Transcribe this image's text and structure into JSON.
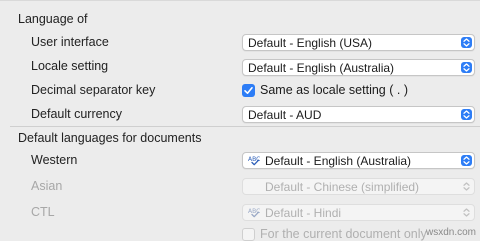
{
  "language_of": {
    "title": "Language of",
    "rows": [
      {
        "label": "User interface",
        "value": "Default - English (USA)"
      },
      {
        "label": "Locale setting",
        "value": "Default - English (Australia)"
      },
      {
        "label": "Decimal separator key",
        "checkbox_label": "Same as locale setting ( . )",
        "checked": true
      },
      {
        "label": "Default currency",
        "value": "Default - AUD"
      }
    ]
  },
  "doc_languages": {
    "title": "Default languages for documents",
    "rows": [
      {
        "label": "Western",
        "value": "Default - English (Australia)",
        "enabled": true
      },
      {
        "label": "Asian",
        "value": "Default - Chinese (simplified)",
        "enabled": false
      },
      {
        "label": "CTL",
        "value": "Default - Hindi",
        "enabled": false
      }
    ],
    "current_doc_only": {
      "label": "For the current document only",
      "checked": false
    }
  },
  "watermark": "wsxdn.com",
  "colors": {
    "accent": "#2d7df6",
    "background": "#ececec",
    "disabled_text": "#b0b0b0"
  }
}
